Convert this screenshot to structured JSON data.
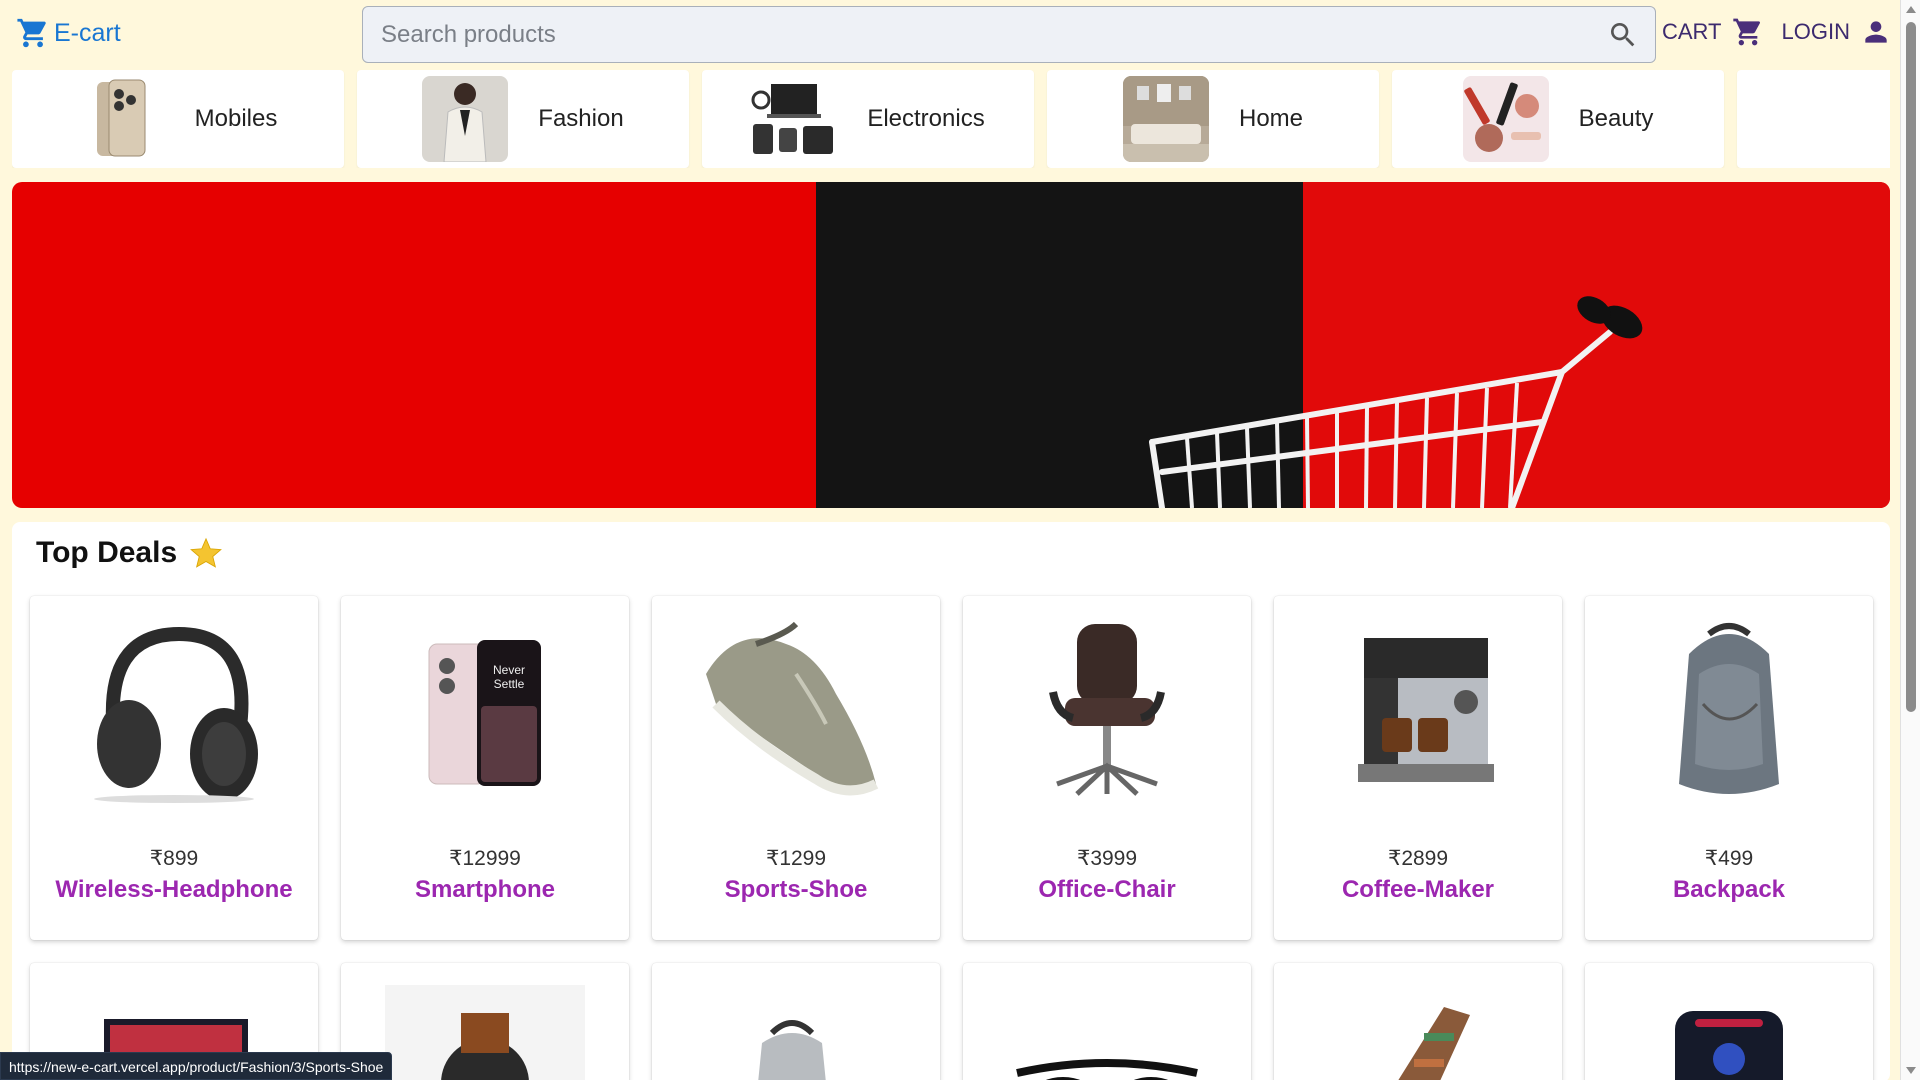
{
  "header": {
    "brand": "E-cart",
    "search_placeholder": "Search products",
    "cart_label": "CART",
    "login_label": "LOGIN"
  },
  "categories": [
    {
      "label": "Mobiles"
    },
    {
      "label": "Fashion"
    },
    {
      "label": "Electronics"
    },
    {
      "label": "Home"
    },
    {
      "label": "Beauty"
    },
    {
      "label": ""
    }
  ],
  "deals": {
    "title": "Top Deals",
    "products": [
      {
        "price": "₹899",
        "name": "Wireless-Headphone"
      },
      {
        "price": "₹12999",
        "name": "Smartphone"
      },
      {
        "price": "₹1299",
        "name": "Sports-Shoe"
      },
      {
        "price": "₹3999",
        "name": "Office-Chair"
      },
      {
        "price": "₹2899",
        "name": "Coffee-Maker"
      },
      {
        "price": "₹499",
        "name": "Backpack"
      }
    ]
  },
  "status_url": "https://new-e-cart.vercel.app/product/Fashion/3/Sports-Shoe",
  "colors": {
    "brand": "#1976d2",
    "page_bg": "#fff8dc",
    "product_name": "#9c27b0",
    "banner_red": "#e60000",
    "banner_black": "#141414"
  }
}
